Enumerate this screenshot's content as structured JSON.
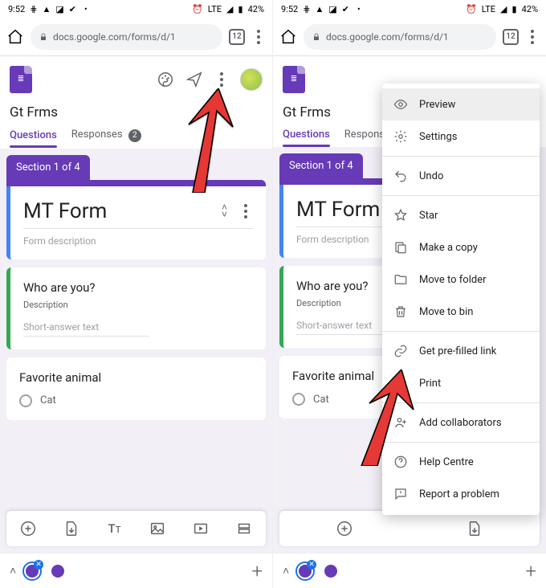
{
  "status": {
    "time": "9:52",
    "network": "LTE",
    "battery": "42%"
  },
  "browser": {
    "url": "docs.google.com/forms/d/1",
    "tab_count": "12"
  },
  "forms": {
    "doc_title": "Gt Frms",
    "tabs": {
      "questions": "Questions",
      "responses": "Responses",
      "response_count": "2"
    },
    "section_label": "Section 1 of 4",
    "form_title": "MT Form",
    "form_desc": "Form description",
    "q1": {
      "title": "Who are you?",
      "desc": "Description",
      "placeholder": "Short-answer text"
    },
    "q2": {
      "title": "Favorite animal",
      "opt1": "Cat"
    }
  },
  "menu": {
    "preview": "Preview",
    "settings": "Settings",
    "undo": "Undo",
    "star": "Star",
    "copy": "Make a copy",
    "move_folder": "Move to folder",
    "move_bin": "Move to bin",
    "prefilled": "Get pre-filled link",
    "print": "Print",
    "collab": "Add collaborators",
    "help": "Help Centre",
    "report": "Report a problem"
  }
}
